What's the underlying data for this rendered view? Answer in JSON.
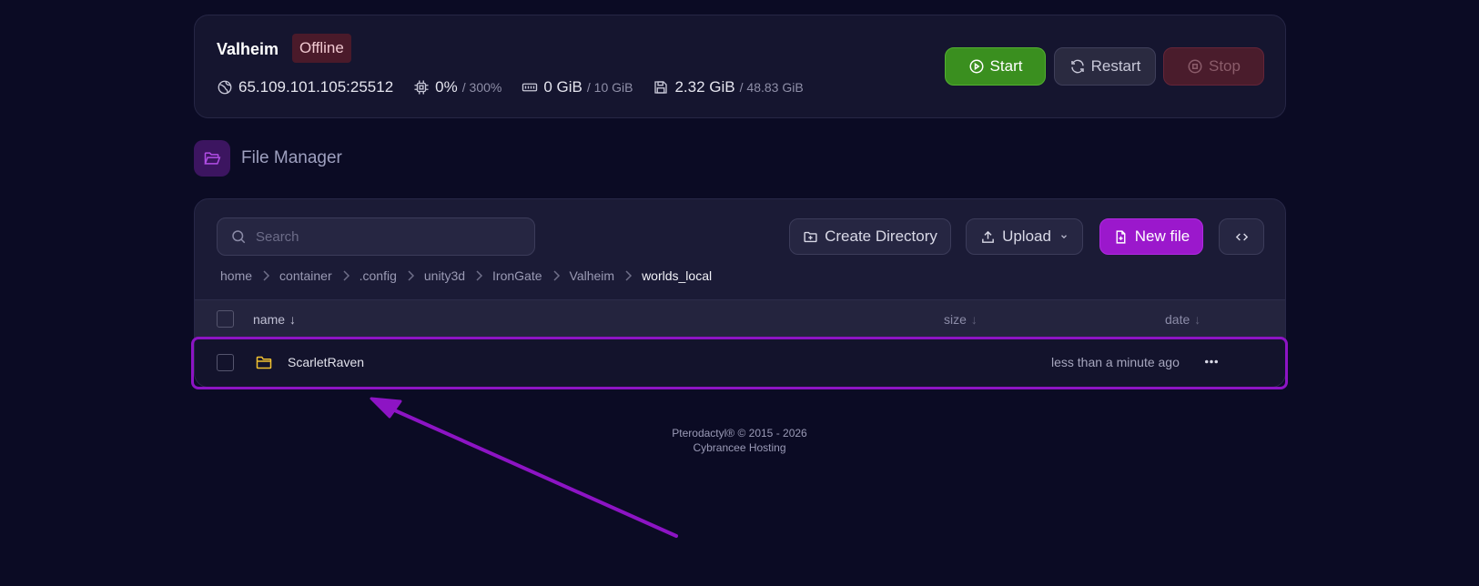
{
  "server": {
    "name": "Valheim",
    "status": "Offline",
    "address": "65.109.101.105:25512",
    "cpu": {
      "value": "0%",
      "limit": "/ 300%"
    },
    "memory": {
      "value": "0 GiB",
      "limit": "/ 10 GiB"
    },
    "disk": {
      "value": "2.32 GiB",
      "limit": "/ 48.83 GiB"
    },
    "buttons": {
      "start": "Start",
      "restart": "Restart",
      "stop": "Stop"
    }
  },
  "file_manager": {
    "title": "File Manager",
    "search_placeholder": "Search",
    "buttons": {
      "create_directory": "Create Directory",
      "upload": "Upload",
      "new_file": "New file"
    },
    "breadcrumb": [
      "home",
      "container",
      ".config",
      "unity3d",
      "IronGate",
      "Valheim",
      "worlds_local"
    ],
    "columns": {
      "name": "name",
      "size": "size",
      "date": "date",
      "sort_arrow": "↓"
    },
    "rows": [
      {
        "type": "folder",
        "name": "ScarletRaven",
        "size": "",
        "date": "less than a minute ago"
      }
    ]
  },
  "footer": {
    "line1": "Pterodactyl® © 2015 - 2026",
    "line2": "Cybrancee Hosting"
  },
  "colors": {
    "background": "#0b0b24",
    "accent": "#9b18cc",
    "start": "#3a8f1f",
    "stop": "#4a1c2c",
    "annotation": "#8d14c4",
    "folder": "#f2c230"
  },
  "icons": [
    "globe-icon",
    "cpu-icon",
    "memory-icon",
    "disk-icon",
    "play-icon",
    "restart-icon",
    "stop-icon",
    "folder-open-icon",
    "search-icon",
    "folder-plus-icon",
    "upload-icon",
    "chevron-down-icon",
    "file-plus-icon",
    "code-icon",
    "chevron-right-icon",
    "folder-icon",
    "more-icon"
  ]
}
